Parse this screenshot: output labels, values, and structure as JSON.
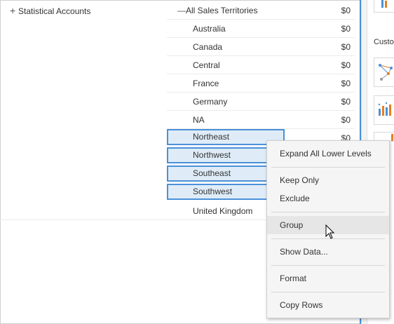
{
  "tree": {
    "statistical_accounts": "Statistical Accounts",
    "all_sales_territories": "All Sales Territories",
    "all_value": "$0"
  },
  "rows": [
    {
      "label": "Australia",
      "value": "$0"
    },
    {
      "label": "Canada",
      "value": "$0"
    },
    {
      "label": "Central",
      "value": "$0"
    },
    {
      "label": "France",
      "value": "$0"
    },
    {
      "label": "Germany",
      "value": "$0"
    },
    {
      "label": "NA",
      "value": "$0"
    },
    {
      "label": "Northeast",
      "value": "$0"
    },
    {
      "label": "Northwest",
      "value": ""
    },
    {
      "label": "Southeast",
      "value": ""
    },
    {
      "label": "Southwest",
      "value": ""
    },
    {
      "label": "United Kingdom",
      "value": ""
    }
  ],
  "side_panel": {
    "custom_label": "Custo"
  },
  "context_menu": {
    "items": [
      "Expand All Lower Levels",
      "Keep Only",
      "Exclude",
      "Group",
      "Show Data...",
      "Format",
      "Copy Rows"
    ]
  },
  "colors": {
    "selection_border": "#4a90d9",
    "selection_fill": "#dfecf8",
    "menu_bg": "#f5f5f5"
  }
}
